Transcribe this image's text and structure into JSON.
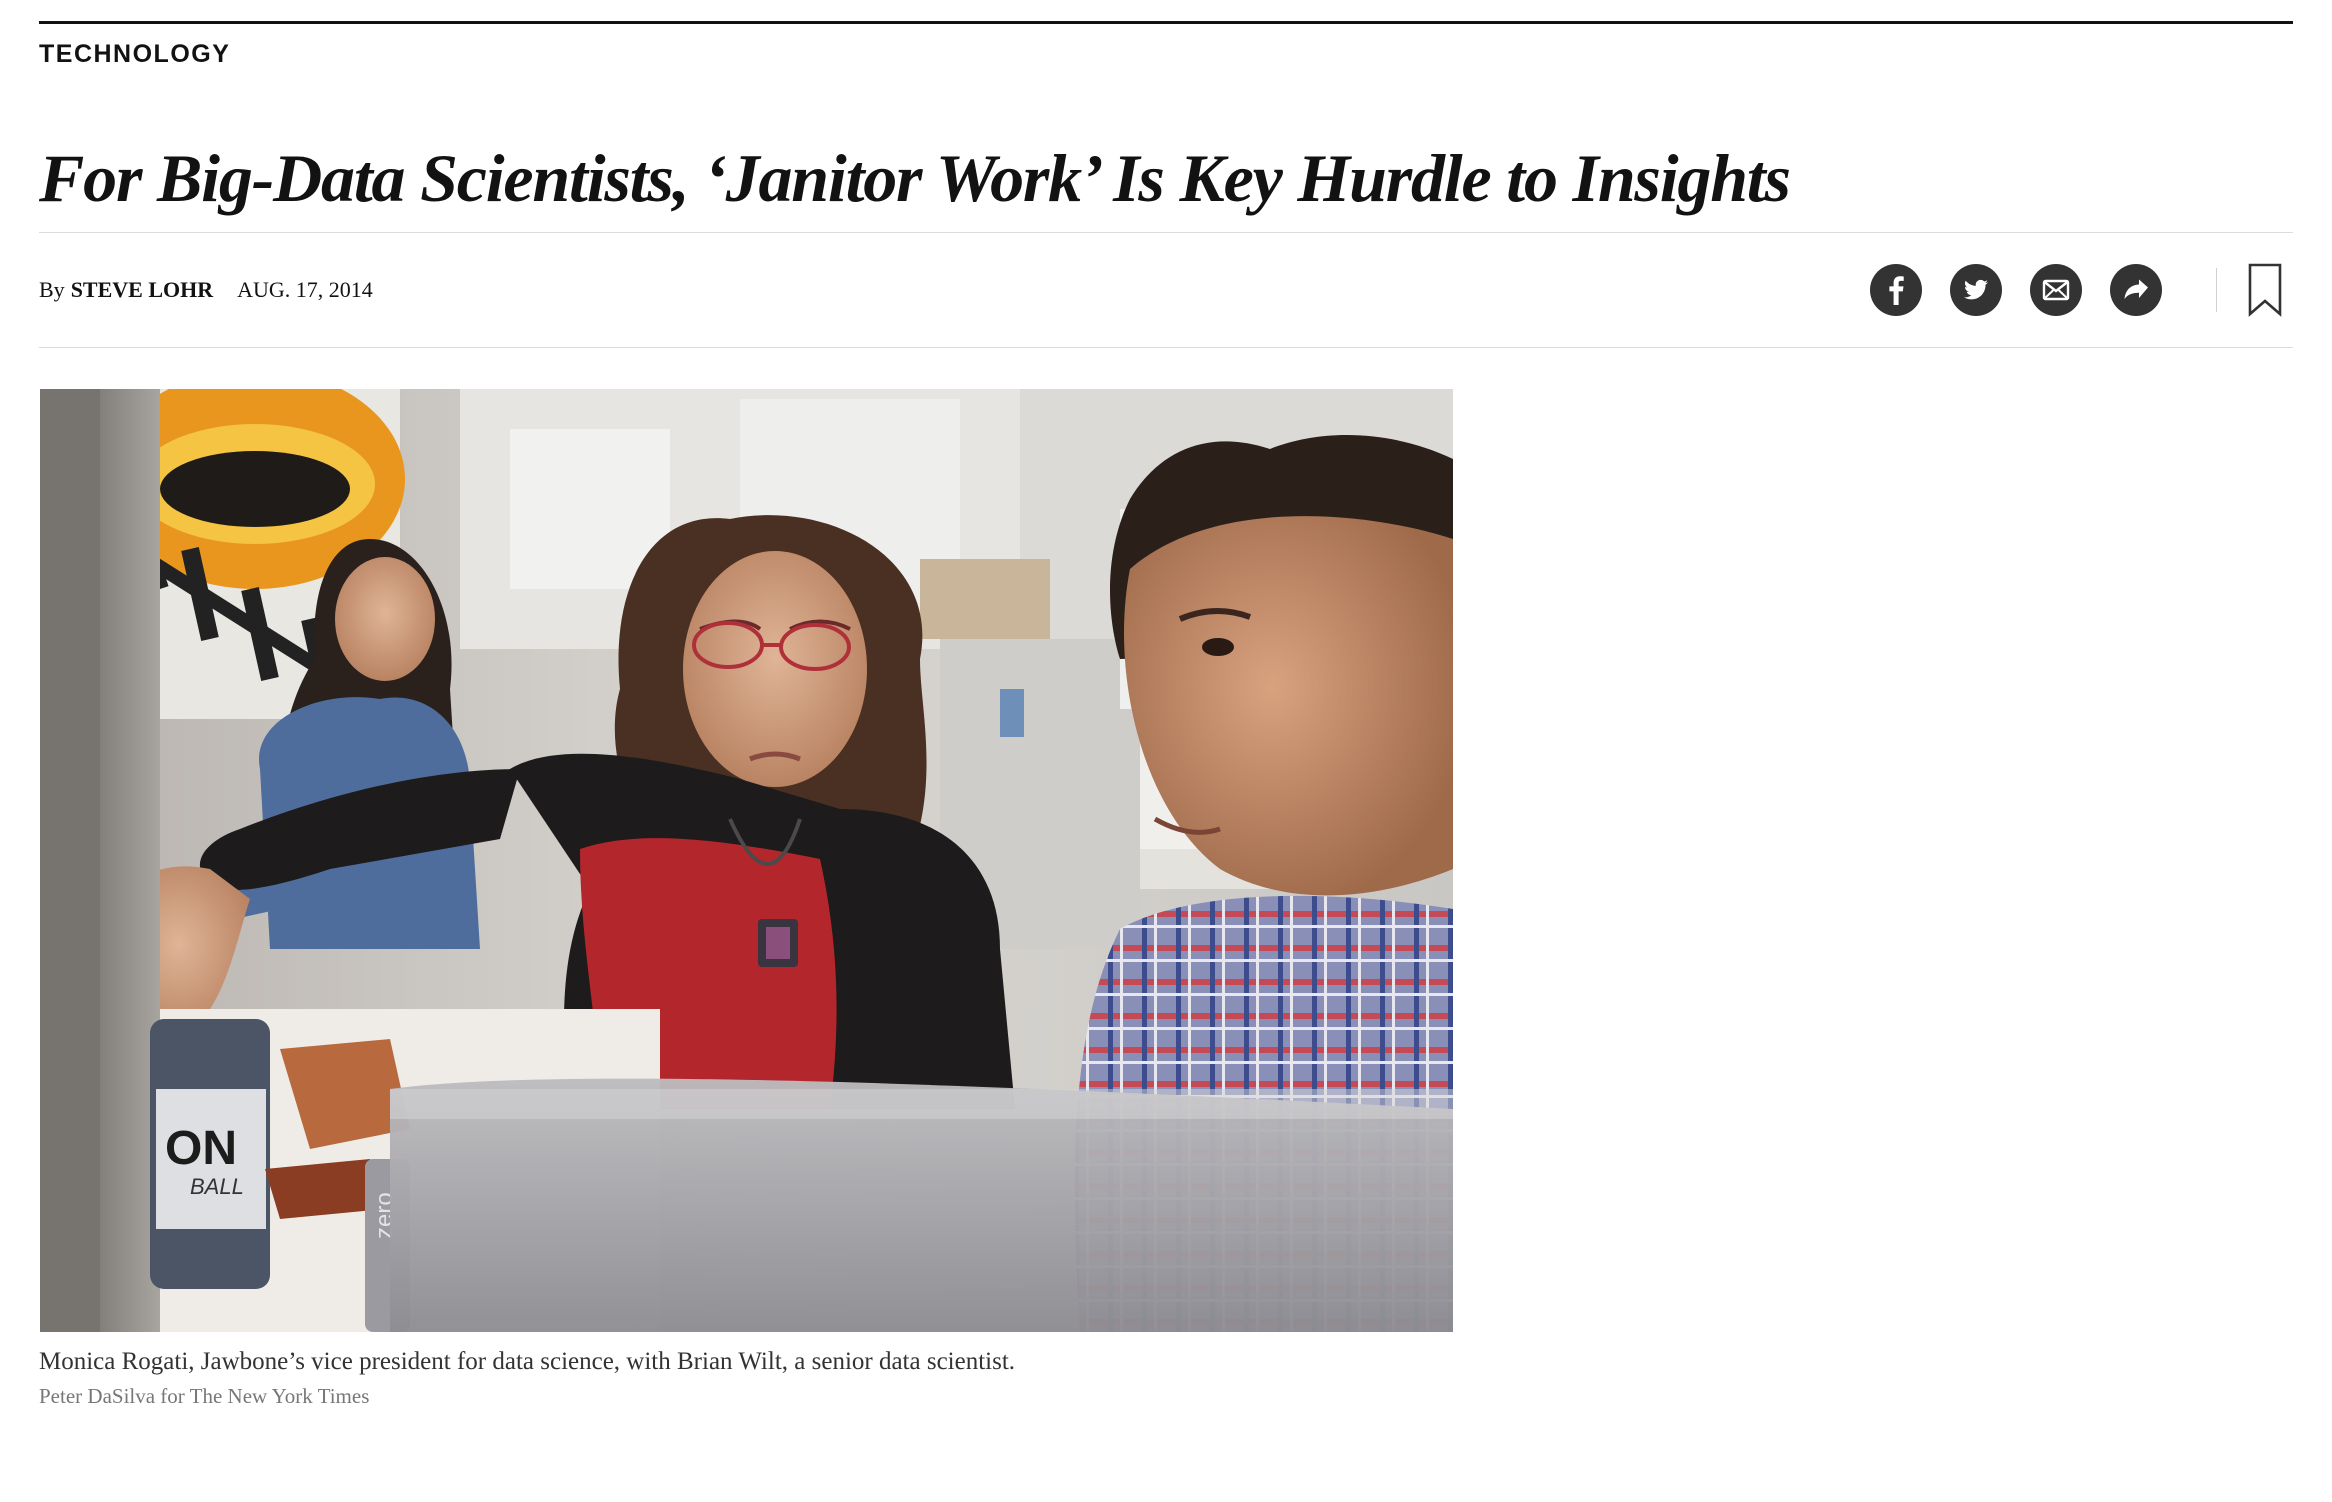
{
  "section": {
    "kicker": "TECHNOLOGY"
  },
  "article": {
    "headline": "For Big-Data Scientists, ‘Janitor Work’ Is Key Hurdle to Insights",
    "byline_prefix": "By",
    "author": "STEVE LOHR",
    "date": "AUG. 17, 2014"
  },
  "share": {
    "icons": [
      "facebook-icon",
      "twitter-icon",
      "email-icon",
      "share-icon",
      "bookmark-icon"
    ],
    "button_color": "#333333"
  },
  "media": {
    "image_subject": "Two data scientists at a computer in an office, a woman pointing at the screen and a man watching",
    "caption": "Monica Rogati, Jawbone’s vice president for data science, with Brian Wilt, a senior data scientist.",
    "credit": "Peter DaSilva for The New York Times",
    "bottle_label": "ON",
    "bottle_sublabel": "BALL",
    "can_label": "zero"
  }
}
